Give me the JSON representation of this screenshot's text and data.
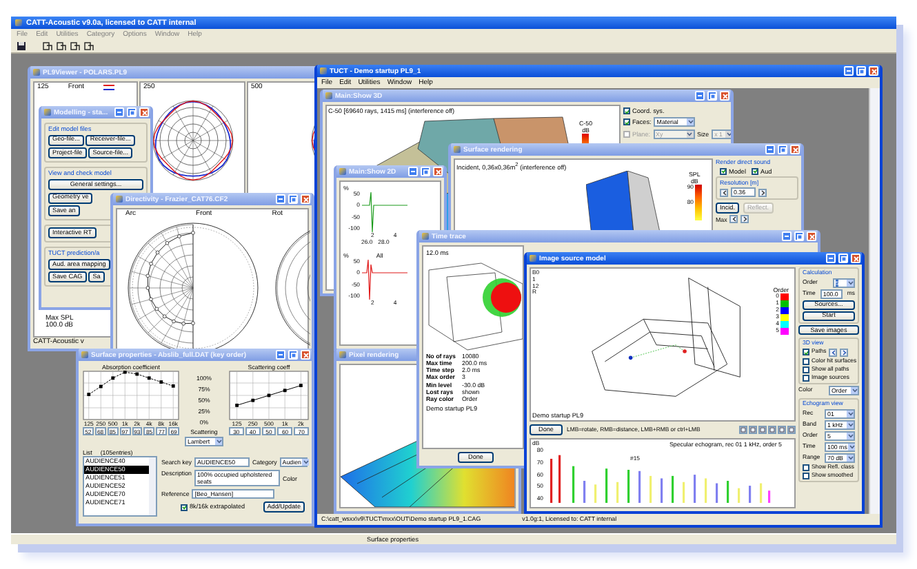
{
  "app": {
    "title": "CATT-Acoustic v9.0a, licensed to CATT internal",
    "menu": [
      "File",
      "Edit",
      "Utilities",
      "Category",
      "Options",
      "Window",
      "Help"
    ],
    "status": "Surface properties"
  },
  "windows": [
    {
      "kind": "polar_viewer",
      "title": "PL9Viewer - POLARS.PL9",
      "active": false,
      "panels": [
        "125",
        "250",
        "500"
      ],
      "front_label": "Front",
      "max_label": "Max SPL",
      "max_value": "100.0 dB",
      "status": "CATT-Acoustic v"
    },
    {
      "kind": "modelling",
      "title": "Modelling - sta...",
      "active": false,
      "groups": [
        {
          "heading": "Edit model files",
          "buttons": [
            "Geo-file...",
            "Receiver-file...",
            "Project-file",
            "Source-file..."
          ]
        },
        {
          "heading": "View and check model",
          "buttons": [
            "General settings...",
            "Geometry ve",
            "Save an"
          ]
        },
        {
          "buttons": [
            "Interactive RT"
          ]
        },
        {
          "heading": "TUCT prediction/a",
          "buttons": [
            "Aud. area mapping",
            "Save CAG",
            "Sa"
          ]
        }
      ]
    },
    {
      "kind": "directivity",
      "title": "Directivity - Frazier_CAT76.CF2",
      "active": false,
      "labels": [
        "Arc",
        "Front",
        "Rot"
      ]
    },
    {
      "kind": "surface_properties",
      "title": "Surface properties - Abslib_full.DAT (key order)",
      "active": false,
      "absorption": {
        "chart_data": {
          "type": "line",
          "title": "Absorption coefficient",
          "categories": [
            "125",
            "250",
            "500",
            "1k",
            "2k",
            "4k",
            "8k",
            "16k"
          ],
          "values": [
            52,
            68,
            85,
            97,
            93,
            85,
            77,
            69
          ],
          "ylim": [
            0,
            100
          ],
          "grid": true,
          "line_style": "dashed",
          "marker": "square",
          "data_labels": true
        }
      },
      "scale": [
        "100%",
        "75%",
        "50%",
        "25%",
        "0%"
      ],
      "scattering_label": "Scattering",
      "scattering_model": "Lambert",
      "scattering": {
        "chart_data": {
          "type": "line",
          "title": "Scattering coeff",
          "categories": [
            "125",
            "250",
            "500",
            "1k",
            "2k"
          ],
          "values": [
            30,
            40,
            50,
            60,
            70
          ],
          "ylim": [
            0,
            100
          ],
          "grid": true,
          "line_style": "solid",
          "marker": "square",
          "data_labels": true
        }
      },
      "list_label": "List",
      "list_count": "(105entries)",
      "list": [
        {
          "label": "AUDIENCE40",
          "selected": false
        },
        {
          "label": "AUDIENCE50",
          "selected": true
        },
        {
          "label": "AUDIENCE51",
          "selected": false
        },
        {
          "label": "AUDIENCE52",
          "selected": false
        },
        {
          "label": "AUDIENCE70",
          "selected": false
        },
        {
          "label": "AUDIENCE71",
          "selected": false
        }
      ],
      "search_label": "Search key",
      "search_value": "AUDIENCE50",
      "category_label": "Category",
      "category_value": "Audien",
      "description_label": "Description",
      "description_value": "100% occupied upholstered seats",
      "color_label": "Color",
      "reference_label": "Reference",
      "reference_value": "[Beo_Hansen]",
      "extrapolated": {
        "label": "8k/16k extrapolated",
        "checked": true
      },
      "add_button": "Add/Update"
    },
    {
      "kind": "tuct",
      "title": "TUCT - Demo startup PL9_1",
      "active": true,
      "menu": [
        "File",
        "Edit",
        "Utilities",
        "Window",
        "Help"
      ],
      "status_path": "C:\\catt_wsxx\\v9\\TUCT\\mxx\\OUT\\Demo startup PL9_1.CAG",
      "status_license": "v1.0g:1, Licensed to: CATT internal",
      "windows": [
        {
          "kind": "show3d",
          "title": "Main:Show 3D",
          "active": false,
          "caption": "C-50 [69640 rays, 1415 ms] (interference off)",
          "legend": [
            "C-50",
            "dB"
          ],
          "options": [
            {
              "kind": "check",
              "label": "Coord. sys.",
              "checked": true,
              "disabled": false
            },
            {
              "kind": "check_select",
              "label": "Faces:",
              "checked": true,
              "value": "Material",
              "disabled": false
            },
            {
              "kind": "check_select",
              "label": "Plane:",
              "checked": false,
              "value": "Xy",
              "disabled": true
            }
          ],
          "size_label": "Size",
          "size_value": "x 1"
        },
        {
          "kind": "show2d",
          "title": "Main:Show 2D",
          "active": false,
          "plots": [
            {
              "unit": "%",
              "yticks": [
                "50",
                "0",
                "-50",
                "-100"
              ],
              "xticks": [
                "2",
                "4"
              ],
              "xticks2": [
                "26.0",
                "28.0"
              ]
            },
            {
              "unit": "%",
              "tag": "All",
              "yticks": [
                "50",
                "0",
                "-50",
                "-100"
              ],
              "xticks": [
                "2",
                "4"
              ]
            }
          ]
        },
        {
          "kind": "pixel_rendering",
          "title": "Pixel rendering",
          "active": false
        },
        {
          "kind": "surface_rendering",
          "title": "Surface rendering",
          "active": false,
          "caption": "Incident, 0,36x0,36m$^{2}$ (interference off)",
          "legend": [
            "SPL",
            "dB",
            "90",
            "80"
          ],
          "panel_title": "Render direct sound",
          "checks": [
            {
              "label": "Model",
              "checked": true
            },
            {
              "label": "Aud",
              "checked": true
            }
          ],
          "resolution_label": "Resolution [m]",
          "resolution_value": "0.36",
          "buttons": [
            {
              "label": "Incid.",
              "disabled": false
            },
            {
              "label": "Reflect.",
              "disabled": true
            }
          ],
          "max_label": "Max"
        },
        {
          "kind": "time_trace",
          "title": "Time trace",
          "active": false,
          "time": "12.0 ms",
          "stats": [
            {
              "label": "No of rays",
              "value": "10080"
            },
            {
              "label": "Max time",
              "value": "200.0 ms"
            },
            {
              "label": "Time step",
              "value": "2.0 ms"
            },
            {
              "label": "Max order",
              "value": "3"
            },
            {
              "label": "Min level",
              "value": "-30.0 dB"
            },
            {
              "label": "Lost rays",
              "value": "shown"
            },
            {
              "label": "Ray color",
              "value": "Order"
            }
          ],
          "model": "Demo startup PL9",
          "done": "Done"
        },
        {
          "kind": "image_source",
          "title": "Image source model",
          "active": true,
          "view_labels": [
            "B0",
            "1",
            "12",
            "R"
          ],
          "order_title": "Order",
          "orders": [
            {
              "label": "0",
              "color": "#ff0000"
            },
            {
              "label": "1",
              "color": "#00c000"
            },
            {
              "label": "2",
              "color": "#0000ff"
            },
            {
              "label": "3",
              "color": "#ffff00"
            },
            {
              "label": "4",
              "color": "#00ffff"
            },
            {
              "label": "5",
              "color": "#ff00ff"
            }
          ],
          "model": "Demo startup PL9",
          "done": "Done",
          "hint": "LMB=rotate, RMB=distance, LMB+RMB or ctrl+LMB",
          "calc_title": "Calculation",
          "order_label": "Order",
          "order_value": "5",
          "time_label": "Time",
          "time_value": "100.0",
          "time_unit": "ms",
          "buttons": [
            "Sources...",
            "Start"
          ],
          "save_button": "Save images",
          "view_title": "3D view",
          "checks": [
            {
              "label": "Paths",
              "checked": true
            },
            {
              "label": "Color hit surfaces",
              "checked": false
            },
            {
              "label": "Show all paths",
              "checked": false
            },
            {
              "label": "Image sources",
              "checked": false
            }
          ],
          "color_label": "Color",
          "color_value": "Order",
          "echo_title": "Echogram view",
          "echo_fields": [
            {
              "label": "Rec",
              "value": "01"
            },
            {
              "label": "Band",
              "value": "1 kHz"
            },
            {
              "label": "Order",
              "value": "5"
            },
            {
              "label": "Time",
              "value": "100 ms"
            },
            {
              "label": "Range",
              "value": "70 dB"
            }
          ],
          "echo_checks": [
            {
              "label": "Show Refl. class",
              "checked": false
            },
            {
              "label": "Show smoothed",
              "checked": false
            }
          ],
          "echogram": {
            "title": "Specular echogram, rec 01 1 kHz, order 5",
            "unit": "dB",
            "yticks": [
              "80",
              "70",
              "60",
              "50",
              "40"
            ],
            "marker": "#15"
          }
        }
      ]
    }
  ]
}
